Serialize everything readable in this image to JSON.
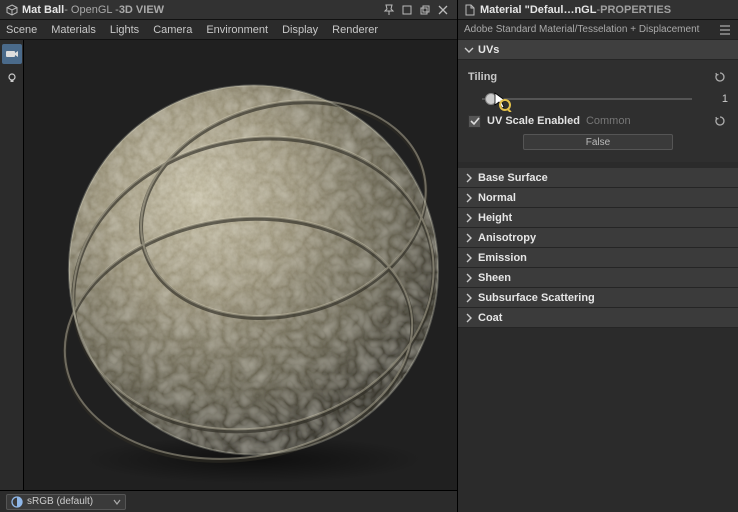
{
  "left": {
    "title_primary": "Mat Ball",
    "title_sep": " - OpenGL - ",
    "title_suffix": "3D VIEW",
    "tabs": [
      "Scene",
      "Materials",
      "Lights",
      "Camera",
      "Environment",
      "Display",
      "Renderer"
    ],
    "colorspace": "sRGB (default)"
  },
  "right": {
    "title_main": "Material \"Defaul…nGL",
    "title_sep": " - ",
    "title_suffix": "PROPERTIES",
    "shader_name": "Adobe Standard Material/Tesselation + Displacement",
    "uvs": {
      "header": "UVs",
      "tiling_label": "Tiling",
      "tiling_value": "1",
      "uv_scale_label": "UV Scale Enabled",
      "uv_scale_hint": "Common",
      "uv_scale_value": "False"
    },
    "sections": [
      "Base Surface",
      "Normal",
      "Height",
      "Anisotropy",
      "Emission",
      "Sheen",
      "Subsurface Scattering",
      "Coat"
    ]
  }
}
